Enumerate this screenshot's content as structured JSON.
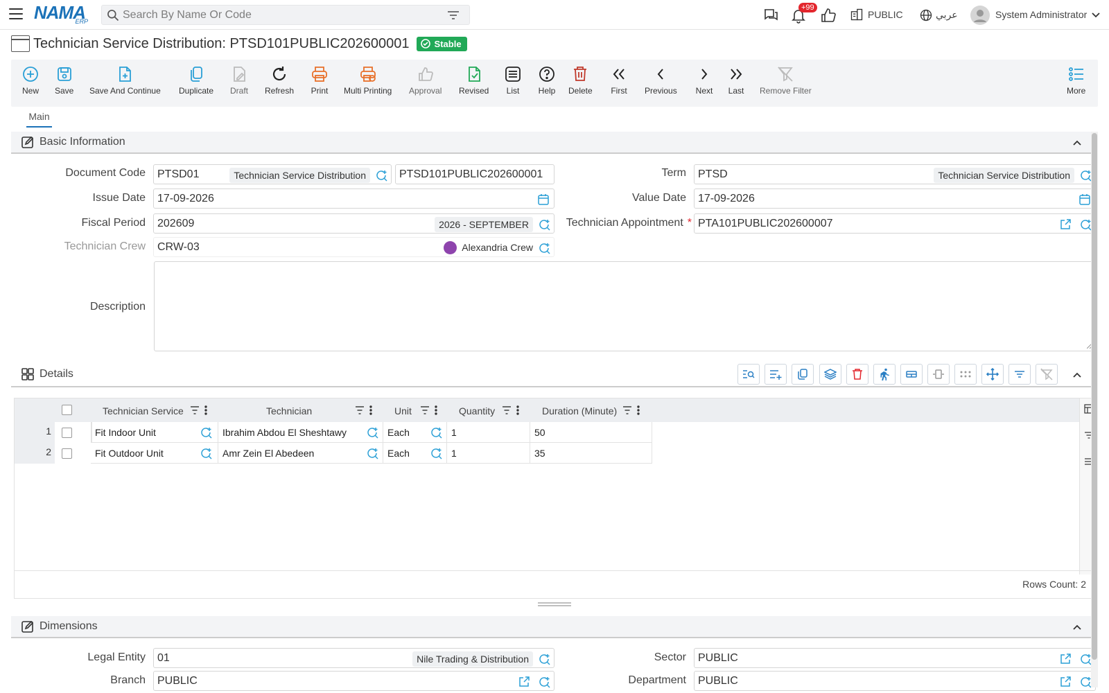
{
  "header": {
    "logo_text": "NAMA",
    "logo_sub": "ERP",
    "search_placeholder": "Search By Name Or Code",
    "notification_count": "+99",
    "branch_label": "PUBLIC",
    "language_label": "عربي",
    "user_name": "System Administrator"
  },
  "page": {
    "title": "Technician Service Distribution: PTSD101PUBLIC202600001",
    "status": "Stable"
  },
  "toolbar": {
    "buttons": [
      {
        "label": "New",
        "icon": "plus-circle-icon"
      },
      {
        "label": "Save",
        "icon": "save-icon"
      },
      {
        "label": "Save And Continue",
        "icon": "file-plus-icon"
      },
      {
        "label": "Duplicate",
        "icon": "copy-icon"
      },
      {
        "label": "Draft",
        "icon": "draft-icon"
      },
      {
        "label": "Refresh",
        "icon": "refresh-icon"
      },
      {
        "label": "Print",
        "icon": "printer-icon"
      },
      {
        "label": "Multi Printing",
        "icon": "multi-print-icon"
      },
      {
        "label": "Approval",
        "icon": "thumbs-up-icon"
      },
      {
        "label": "Revised",
        "icon": "file-check-icon"
      },
      {
        "label": "List",
        "icon": "list-icon"
      },
      {
        "label": "Help",
        "icon": "help-icon"
      },
      {
        "label": "Delete",
        "icon": "trash-icon"
      },
      {
        "label": "First",
        "icon": "chevrons-left-icon"
      },
      {
        "label": "Previous",
        "icon": "chevron-left-icon"
      },
      {
        "label": "Next",
        "icon": "chevron-right-icon"
      },
      {
        "label": "Last",
        "icon": "chevrons-right-icon"
      },
      {
        "label": "Remove Filter",
        "icon": "filter-off-icon"
      },
      {
        "label": "More",
        "icon": "more-list-icon"
      }
    ]
  },
  "tabs": [
    "Main"
  ],
  "basic_info": {
    "title": "Basic Information",
    "document_code": {
      "label": "Document Code",
      "code": "PTSD01",
      "name": "Technician Service Distribution",
      "number": "PTSD101PUBLIC202600001"
    },
    "term": {
      "label": "Term",
      "code": "PTSD",
      "name": "Technician Service Distribution"
    },
    "issue_date": {
      "label": "Issue Date",
      "value": "17-09-2026"
    },
    "value_date": {
      "label": "Value Date",
      "value": "17-09-2026"
    },
    "fiscal_period": {
      "label": "Fiscal Period",
      "code": "202609",
      "name": "2026 - SEPTEMBER"
    },
    "technician_appointment": {
      "label": "Technician Appointment",
      "required_mark": "*",
      "value": "PTA101PUBLIC202600007"
    },
    "technician_crew": {
      "label": "Technician Crew",
      "code": "CRW-03",
      "name": "Alexandria Crew",
      "color": "#8e44ad"
    },
    "description": {
      "label": "Description",
      "value": ""
    }
  },
  "details": {
    "title": "Details",
    "columns": [
      "Technician Service",
      "Technician",
      "Unit",
      "Quantity",
      "Duration (Minute)"
    ],
    "rows": [
      {
        "no": "1",
        "service": "Fit Indoor Unit",
        "technician": "Ibrahim Abdou El Sheshtawy",
        "unit": "Each",
        "quantity": "1",
        "duration": "50"
      },
      {
        "no": "2",
        "service": "Fit Outdoor Unit",
        "technician": "Amr Zein El Abedeen",
        "unit": "Each",
        "quantity": "1",
        "duration": "35"
      }
    ],
    "rows_count": "Rows Count: 2"
  },
  "dimensions": {
    "title": "Dimensions",
    "legal_entity": {
      "label": "Legal Entity",
      "code": "01",
      "name": "Nile Trading & Distribution"
    },
    "sector": {
      "label": "Sector",
      "value": "PUBLIC"
    },
    "branch": {
      "label": "Branch",
      "value": "PUBLIC"
    },
    "department": {
      "label": "Department",
      "value": "PUBLIC"
    }
  },
  "colors": {
    "brand": "#1b72b8",
    "stable": "#21a957",
    "accent_icon": "#2a9fd6",
    "print_orange": "#e8702a",
    "delete_red": "#c0392b"
  }
}
